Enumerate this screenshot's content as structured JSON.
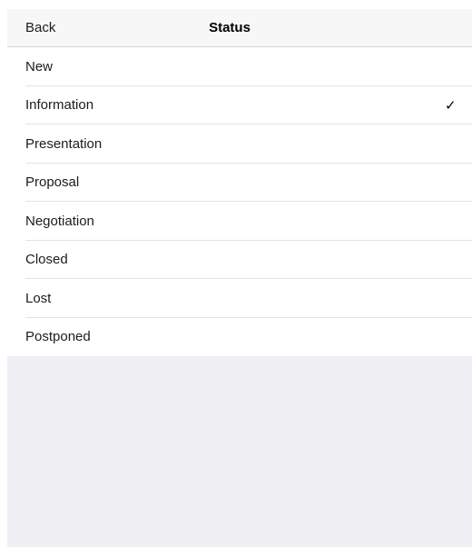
{
  "navbar": {
    "back_label": "Back",
    "title": "Status"
  },
  "statuses": [
    {
      "label": "New",
      "checked": false
    },
    {
      "label": "Information",
      "checked": true
    },
    {
      "label": "Presentation",
      "checked": false
    },
    {
      "label": "Proposal",
      "checked": false
    },
    {
      "label": "Negotiation",
      "checked": false
    },
    {
      "label": "Closed",
      "checked": false
    },
    {
      "label": "Lost",
      "checked": false
    },
    {
      "label": "Postponed",
      "checked": false
    }
  ],
  "check_glyph": "✓",
  "colors": {
    "background": "#efeff4",
    "navbar": "#f7f7f7",
    "row": "#ffffff",
    "separator": "#e3e3e6"
  }
}
